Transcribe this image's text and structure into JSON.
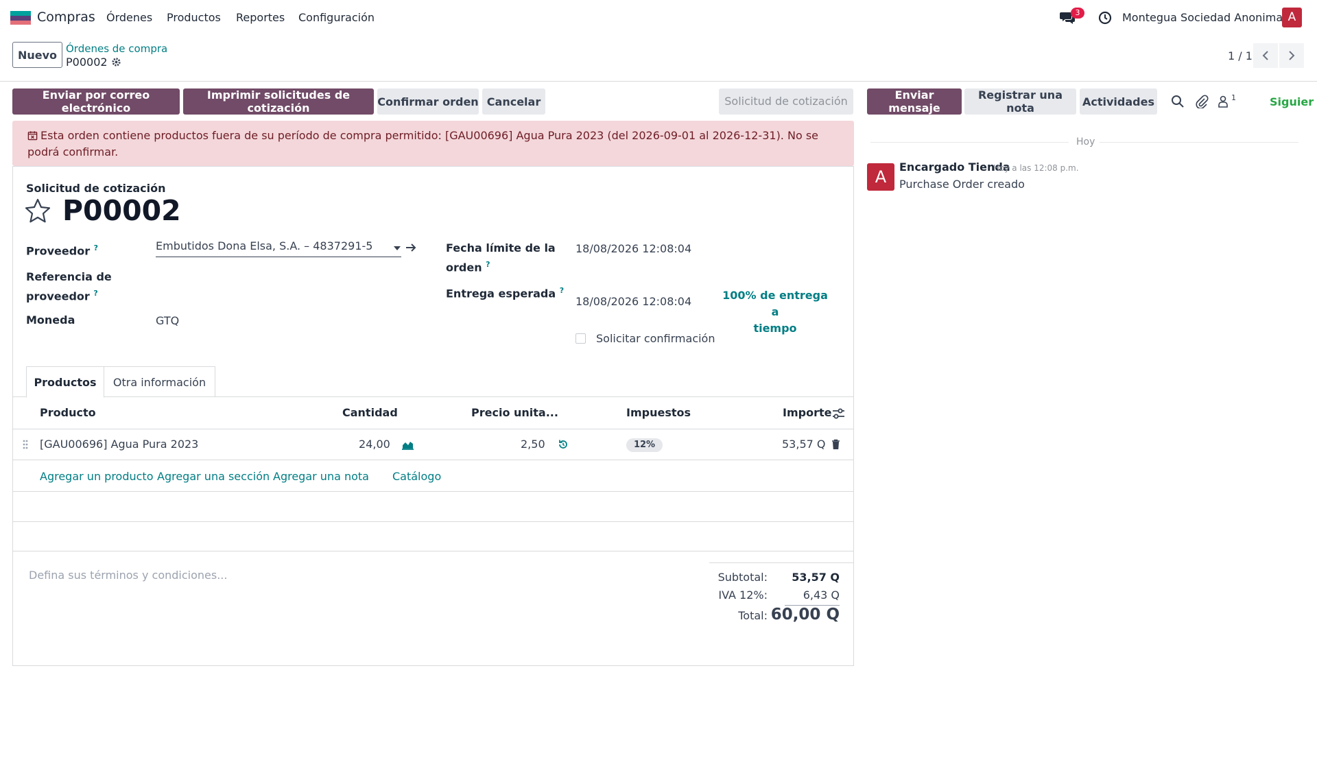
{
  "nav": {
    "app_name": "Compras",
    "menu": [
      "Órdenes",
      "Productos",
      "Reportes",
      "Configuración"
    ],
    "chat_count": "3",
    "company": "Montegua Sociedad Anonima",
    "avatar_letter": "A",
    "logo_colors": [
      "#00a09d",
      "#5a3e7a",
      "#e46f78"
    ]
  },
  "control": {
    "new_label": "Nuevo",
    "breadcrumb_parent": "Órdenes de compra",
    "breadcrumb_current": "P00002",
    "pager": "1 / 1"
  },
  "actions": {
    "send_email": "Enviar por correo electrónico",
    "print_rfq": "Imprimir solicitudes de cotización",
    "confirm": "Confirmar orden",
    "cancel": "Cancelar",
    "stage": "Solicitud de cotización"
  },
  "alert": {
    "text": "Esta orden contiene productos fuera de su período de compra permitido: [GAU00696] Agua Pura 2023 (del 2026-09-01 al 2026-12-31). No se podrá confirmar."
  },
  "form": {
    "subtitle": "Solicitud de cotización",
    "reference": "P00002",
    "vendor_label": "Proveedor",
    "vendor_value": "Embutidos Dona Elsa, S.A. – 4837291-5",
    "vendor_ref_label_1": "Referencia de",
    "vendor_ref_label_2": "proveedor",
    "currency_label": "Moneda",
    "currency_value": "GTQ",
    "deadline_label_1": "Fecha límite de la",
    "deadline_label_2": "orden",
    "deadline_value": "18/08/2026 12:08:04",
    "expected_label": "Entrega esperada",
    "expected_value": "18/08/2026 12:08:04",
    "on_time_1": "100% de entrega a",
    "on_time_2": "tiempo",
    "ask_confirm_label": "Solicitar confirmación",
    "tooltip_mark": "?"
  },
  "tabs": {
    "products": "Productos",
    "other": "Otra información"
  },
  "table": {
    "headers": {
      "product": "Producto",
      "quantity": "Cantidad",
      "unit_price": "Precio unita...",
      "taxes": "Impuestos",
      "amount": "Importe"
    },
    "rows": [
      {
        "product": "[GAU00696] Agua Pura 2023",
        "quantity": "24,00",
        "unit_price": "2,50",
        "tax": "12%",
        "amount": "53,57 Q"
      }
    ],
    "add_product": "Agregar un producto",
    "add_section": "Agregar una sección",
    "add_note": "Agregar una nota",
    "catalog": "Catálogo"
  },
  "totals": {
    "terms_placeholder": "Defina sus términos y condiciones...",
    "subtotal_label": "Subtotal:",
    "subtotal_value": "53,57 Q",
    "tax_label": "IVA 12%:",
    "tax_value": "6,43 Q",
    "total_label": "Total:",
    "total_value": "60,00 Q"
  },
  "chatter": {
    "send_message": "Enviar mensaje",
    "log_note": "Registrar una nota",
    "activities": "Actividades",
    "followers_count": "1",
    "follow": "Siguier",
    "date_separator": "Hoy",
    "message": {
      "avatar_letter": "A",
      "author": "Encargado Tienda",
      "time": "Hoy a las 12:08 p.m.",
      "body": "Purchase Order creado"
    }
  }
}
